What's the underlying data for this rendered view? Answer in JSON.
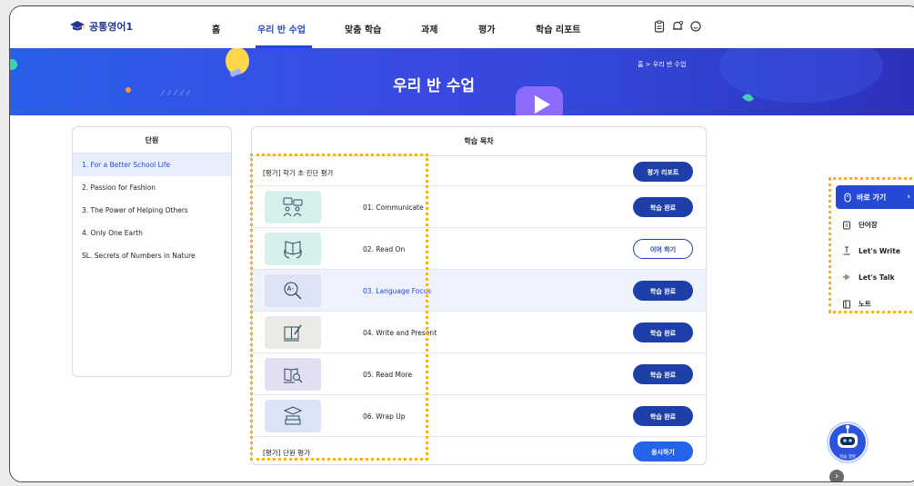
{
  "app": {
    "title": "공통영어1"
  },
  "nav": {
    "items": [
      {
        "label": "홈",
        "active": false
      },
      {
        "label": "우리 반 수업",
        "active": true
      },
      {
        "label": "맞춤 학습",
        "active": false
      },
      {
        "label": "과제",
        "active": false
      },
      {
        "label": "평가",
        "active": false
      },
      {
        "label": "학습 리포트",
        "active": false
      }
    ],
    "icons": [
      "clipboard-icon",
      "bell-icon",
      "profile-icon"
    ]
  },
  "banner": {
    "title": "우리 반 수업",
    "breadcrumb": "홈 > 우리 반 수업"
  },
  "units": {
    "header": "단원",
    "items": [
      {
        "label": "1. For a Better School Life",
        "active": true
      },
      {
        "label": "2. Passion for Fashion",
        "active": false
      },
      {
        "label": "3. The Power of Helping Others",
        "active": false
      },
      {
        "label": "4. Only One Earth",
        "active": false
      },
      {
        "label": "SL. Secrets of Numbers in Nature",
        "active": false
      }
    ]
  },
  "contents": {
    "header": "학습 목차",
    "pre_test": {
      "label": "[평가] 학기 초 진단 평가",
      "button": "평가 리포트"
    },
    "lessons": [
      {
        "title": "01. Communicate",
        "button": "학습 완료",
        "state": "done",
        "icon": "communicate-icon",
        "thumb_color": "#d6f0ec"
      },
      {
        "title": "02. Read On",
        "button": "이어 하기",
        "state": "continue",
        "icon": "book-read-icon",
        "thumb_color": "#d6f0ec"
      },
      {
        "title": "03. Language Focus",
        "button": "학습 완료",
        "state": "done",
        "icon": "magnifier-az-icon",
        "thumb_color": "#dfe3f7"
      },
      {
        "title": "04. Write and Present",
        "button": "학습 완료",
        "state": "done",
        "icon": "write-icon",
        "thumb_color": "#eceae6"
      },
      {
        "title": "05. Read More",
        "button": "학습 완료",
        "state": "done",
        "icon": "book-search-icon",
        "thumb_color": "#e2def3"
      },
      {
        "title": "06. Wrap Up",
        "button": "학습 완료",
        "state": "done",
        "icon": "graduation-books-icon",
        "thumb_color": "#dce4f7"
      }
    ],
    "unit_test": {
      "label": "[평가] 단원 평가",
      "button": "응시하기"
    }
  },
  "quick": {
    "header": "바로 가기",
    "items": [
      {
        "label": "단어장",
        "icon": "vocabulary-icon"
      },
      {
        "label": "Let's Write",
        "icon": "pencil-underline-icon"
      },
      {
        "label": "Let's Talk",
        "icon": "voice-wave-icon"
      },
      {
        "label": "노트",
        "icon": "note-icon"
      }
    ]
  },
  "assistant": {
    "label": "학습 챗봇"
  },
  "colors": {
    "primary": "#2548d6",
    "button": "#1f3fa8",
    "highlight": "#f4b41a"
  }
}
